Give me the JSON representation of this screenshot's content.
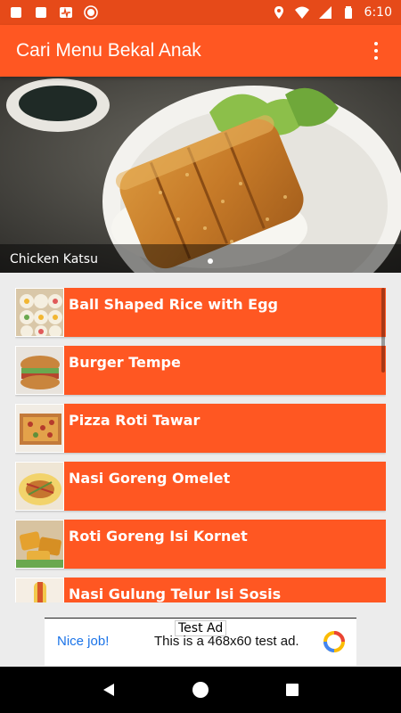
{
  "status_bar": {
    "time": "6:10",
    "icons": [
      "square-icon",
      "square-icon",
      "pulse-icon",
      "record-icon",
      "location-icon",
      "wifi-icon",
      "signal-icon",
      "battery-icon"
    ]
  },
  "app_bar": {
    "title": "Cari Menu Bekal Anak",
    "menu_icon": "more-vert-icon"
  },
  "banner": {
    "caption": "Chicken Katsu",
    "active_slide": 1
  },
  "menu": {
    "items": [
      {
        "label": "Ball Shaped Rice with Egg"
      },
      {
        "label": "Burger Tempe"
      },
      {
        "label": "Pizza Roti Tawar"
      },
      {
        "label": "Nasi Goreng Omelet"
      },
      {
        "label": "Roti Goreng Isi Kornet"
      },
      {
        "label": "Nasi Gulung Telur Isi Sosis"
      }
    ]
  },
  "ad": {
    "tag": "Test Ad",
    "nice": "Nice job!",
    "text": "This is a 468x60 test ad."
  },
  "nav": {
    "icons": [
      "back-icon",
      "home-icon",
      "recents-icon"
    ]
  },
  "colors": {
    "primary": "#ff5722",
    "primary_dark": "#e64a19"
  }
}
